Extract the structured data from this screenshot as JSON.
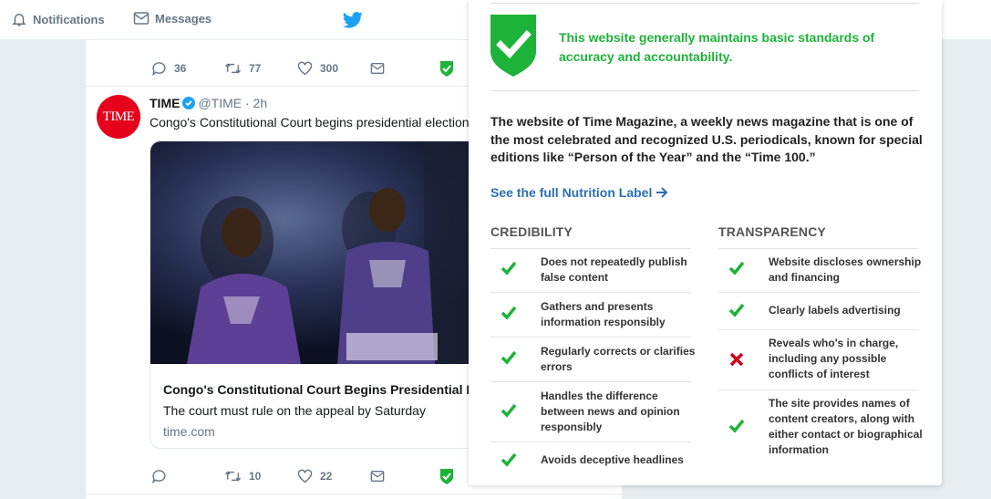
{
  "nav": {
    "notifications_label": "Notifications",
    "messages_label": "Messages"
  },
  "prev_tweet_actions": {
    "replies": "36",
    "retweets": "77",
    "likes": "300"
  },
  "tweet": {
    "avatar_text": "TIME",
    "name": "TIME",
    "handle": "@TIME",
    "time": "· 2h",
    "text": "Congo's Constitutional Court begins presidential election",
    "card": {
      "title": "Congo's Constitutional Court Begins Presidential Election",
      "description": "The court must rule on the appeal by Saturday",
      "domain": "time.com"
    },
    "actions": {
      "replies": "",
      "retweets": "10",
      "likes": "22"
    }
  },
  "popup": {
    "verdict": "This website generally maintains basic standards of accuracy and accountability.",
    "verdict_color": "#1db339",
    "description": "The website of Time Magazine, a weekly news magazine that is one of the most celebrated and recognized U.S. periodicals, known for special editions like “Person of the Year” and the “Time 100.”",
    "full_label_link": "See the full Nutrition Label",
    "credibility": {
      "heading": "CREDIBILITY",
      "items": [
        {
          "label": "Does not repeatedly publish false content",
          "pass": true
        },
        {
          "label": "Gathers and presents information responsibly",
          "pass": true
        },
        {
          "label": "Regularly corrects or clarifies errors",
          "pass": true
        },
        {
          "label": "Handles the difference between news and opinion responsibly",
          "pass": true
        },
        {
          "label": "Avoids deceptive headlines",
          "pass": true
        }
      ]
    },
    "transparency": {
      "heading": "TRANSPARENCY",
      "items": [
        {
          "label": "Website discloses ownership and financing",
          "pass": true
        },
        {
          "label": "Clearly labels advertising",
          "pass": true
        },
        {
          "label": "Reveals who's in charge, including any possible conflicts of interest",
          "pass": false
        },
        {
          "label": "The site provides names of content creators, along with either contact or biographical information",
          "pass": true
        }
      ]
    }
  },
  "colors": {
    "pass": "#1db339",
    "fail": "#d0021b",
    "link": "#2c6fb3",
    "twitter_blue": "#1da1f2"
  }
}
